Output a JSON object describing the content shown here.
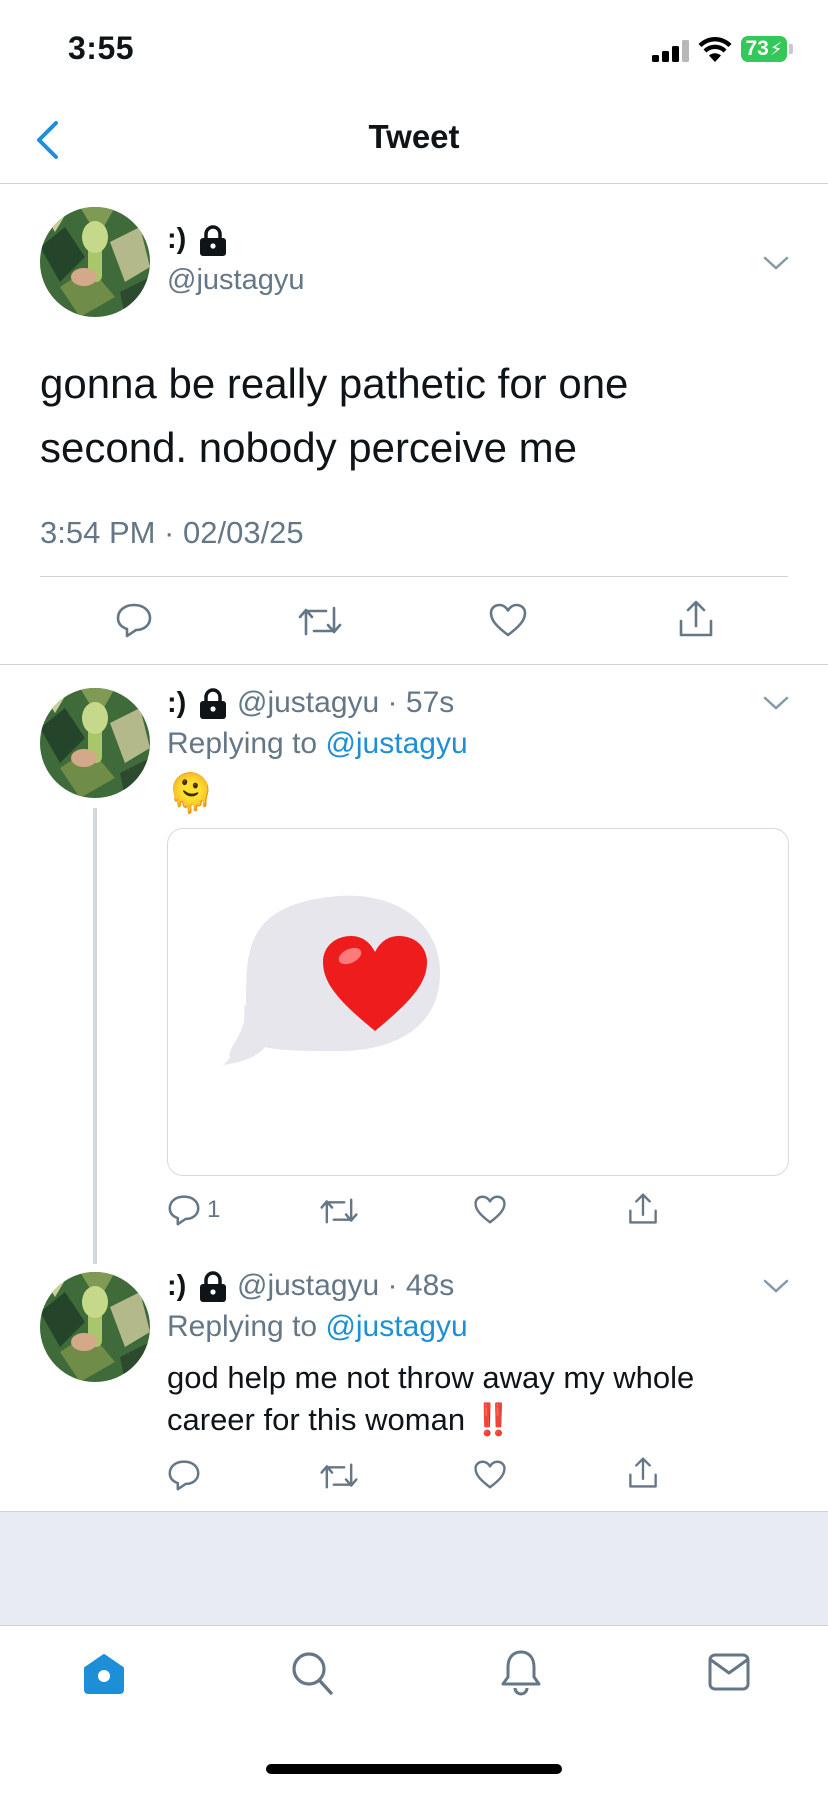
{
  "status_bar": {
    "time": "3:55",
    "battery": "73"
  },
  "nav": {
    "title": "Tweet"
  },
  "main_tweet": {
    "display_name": ":)",
    "handle": "@justagyu",
    "text_line1": "gonna be really pathetic for one",
    "text_line2": "second. nobody perceive me",
    "timestamp": "3:54 PM · 02/03/25"
  },
  "replies": [
    {
      "display_name": ":)",
      "handle": "@justagyu",
      "dot": "·",
      "age": "57s",
      "replying_prefix": "Replying to",
      "replying_to": "@justagyu",
      "emoji_text": "🫠",
      "reply_count": "1",
      "media_emoji": "❤️"
    },
    {
      "display_name": ":)",
      "handle": "@justagyu",
      "dot": "·",
      "age": "48s",
      "replying_prefix": "Replying to",
      "replying_to": "@justagyu",
      "text_line1": "god help me not throw away my whole",
      "text_line2": "career for this woman",
      "text_emoji": "‼️"
    }
  ],
  "colors": {
    "accent": "#1d8fd6",
    "muted": "#657786",
    "battery": "#34c759",
    "footer_bg": "#e8ebf2"
  },
  "icons": [
    "back-chevron-icon",
    "lock-icon",
    "chevron-down-icon",
    "reply-icon",
    "retweet-icon",
    "like-icon",
    "share-icon",
    "home-icon",
    "search-icon",
    "notifications-icon",
    "messages-icon"
  ]
}
